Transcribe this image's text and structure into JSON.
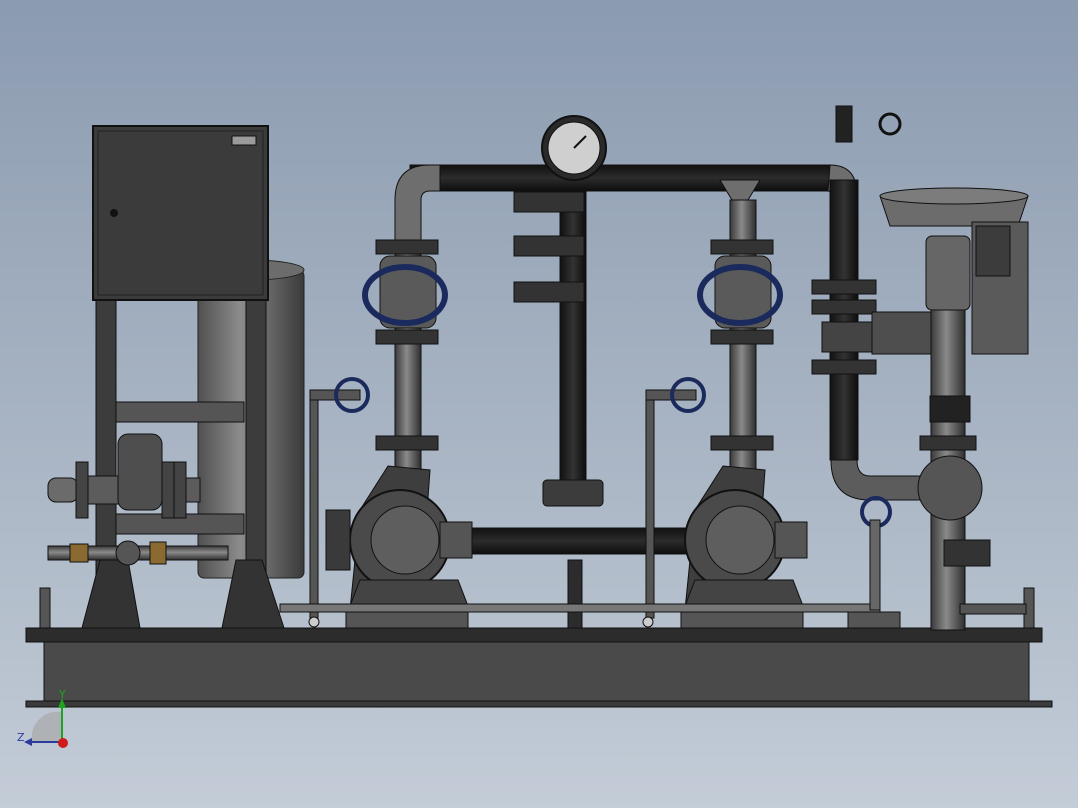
{
  "viewport": {
    "background_top": "#8b9bb0",
    "background_bottom": "#c3ccd7"
  },
  "model": {
    "steel_color": "#4b4b4b",
    "dark_color": "#1b1b1b",
    "handwheel_color": "#1b2a5c",
    "components": [
      "control-cabinet",
      "pressure-tank",
      "pump-1",
      "pump-2",
      "pressure-gauge",
      "control-valve",
      "skid-base",
      "manifold"
    ]
  },
  "triad": {
    "y_label": "Y",
    "z_label": "Z",
    "y_color": "#1fa21f",
    "z_color": "#2b3b9c",
    "origin_color": "#d01a1a"
  }
}
